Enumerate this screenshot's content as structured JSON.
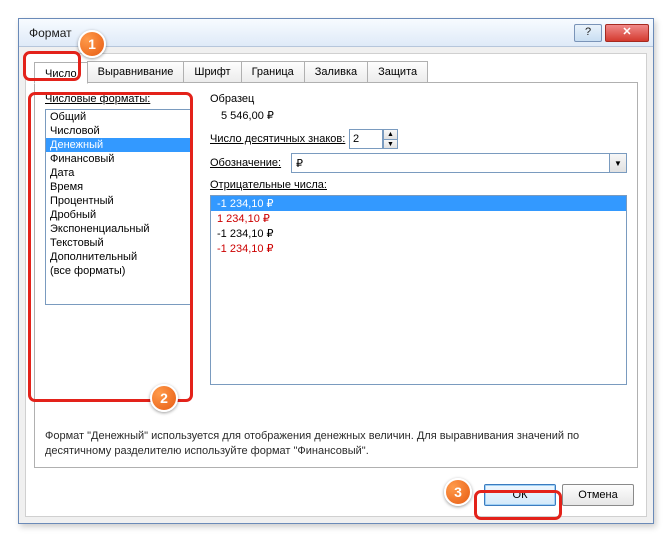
{
  "window": {
    "title": "Формат "
  },
  "tabs": [
    "Число",
    "Выравнивание",
    "Шрифт",
    "Граница",
    "Заливка",
    "Защита"
  ],
  "labels": {
    "categories": "Числовые форматы:",
    "sample": "Образец",
    "decimals": "Число десятичных знаков:",
    "symbol": "Обозначение:",
    "negative": "Отрицательные числа:"
  },
  "categories": [
    "Общий",
    "Числовой",
    "Денежный",
    "Финансовый",
    "Дата",
    "Время",
    "Процентный",
    "Дробный",
    "Экспоненциальный",
    "Текстовый",
    "Дополнительный",
    "(все форматы)"
  ],
  "selected_category_index": 2,
  "sample_value": "5 546,00 ₽",
  "decimal_places": "2",
  "symbol_value": "₽",
  "negatives": [
    {
      "text": "-1 234,10 ₽",
      "color": "#ffffff"
    },
    {
      "text": "1 234,10 ₽",
      "color": "#cc0000"
    },
    {
      "text": "-1 234,10 ₽",
      "color": "#000000"
    },
    {
      "text": "-1 234,10 ₽",
      "color": "#cc0000"
    }
  ],
  "selected_negative_index": 0,
  "description": "Формат \"Денежный\" используется для отображения денежных величин. Для выравнивания значений по десятичному разделителю используйте формат \"Финансовый\".",
  "buttons": {
    "ok": "ОК",
    "cancel": "Отмена"
  },
  "callouts": {
    "a": "1",
    "b": "2",
    "c": "3"
  }
}
